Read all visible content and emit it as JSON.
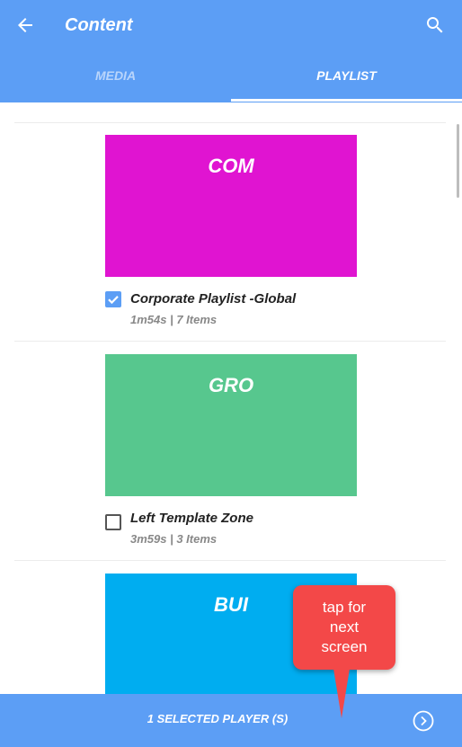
{
  "header": {
    "title": "Content",
    "tabs": [
      {
        "label": "MEDIA",
        "active": false
      },
      {
        "label": "PLAYLIST",
        "active": true
      }
    ],
    "back_icon": "arrow-back-icon",
    "search_icon": "search-icon",
    "color": "#5c9ef5"
  },
  "playlists": [
    {
      "thumb_label": "COM",
      "thumb_color": "#e014d1",
      "name": "Corporate Playlist -Global",
      "meta": "1m54s | 7 Items",
      "checked": true
    },
    {
      "thumb_label": "GRO",
      "thumb_color": "#57c78e",
      "name": "Left Template Zone",
      "meta": "3m59s | 3 Items",
      "checked": false
    },
    {
      "thumb_label": "BUI",
      "thumb_color": "#00adf0"
    }
  ],
  "footer": {
    "selected_label": "1 SELECTED PLAYER (S)",
    "next_icon": "chevron-right-circle-icon"
  },
  "callout": {
    "lines": [
      "tap for",
      "next",
      "screen"
    ],
    "color": "#f34848"
  }
}
